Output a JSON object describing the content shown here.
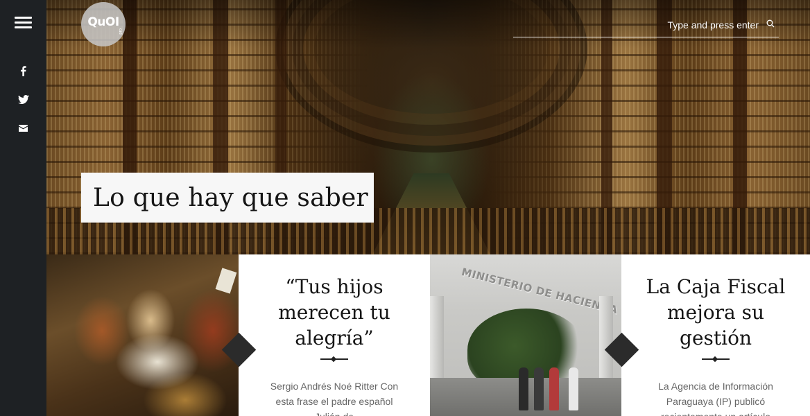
{
  "sidebar": {
    "menu_icon": "hamburger-menu-icon",
    "social": [
      {
        "icon": "facebook-icon"
      },
      {
        "icon": "twitter-icon"
      },
      {
        "icon": "mail-icon"
      }
    ]
  },
  "header": {
    "logo": {
      "text": "QuOI",
      "sub": "pro"
    },
    "search": {
      "placeholder": "Type and press enter",
      "icon": "search-icon"
    }
  },
  "hero": {
    "title": "Lo que hay que saber"
  },
  "cards": [
    {
      "title": "“Tus hijos merecen tu alegría”",
      "excerpt": "Sergio Andrés Noé Ritter Con esta frase el padre español Julián de"
    },
    {
      "title": "La Caja Fiscal mejora su gestión",
      "excerpt": "La Agencia de Información Paraguaya (IP) publicó recientemente un artículo",
      "image_sign": "MINISTERIO DE HACIENDA"
    }
  ],
  "colors": {
    "sidebar_bg": "#1e2124",
    "text_dark": "#151515",
    "text_muted": "#666666",
    "diamond": "#2b2b2b"
  }
}
